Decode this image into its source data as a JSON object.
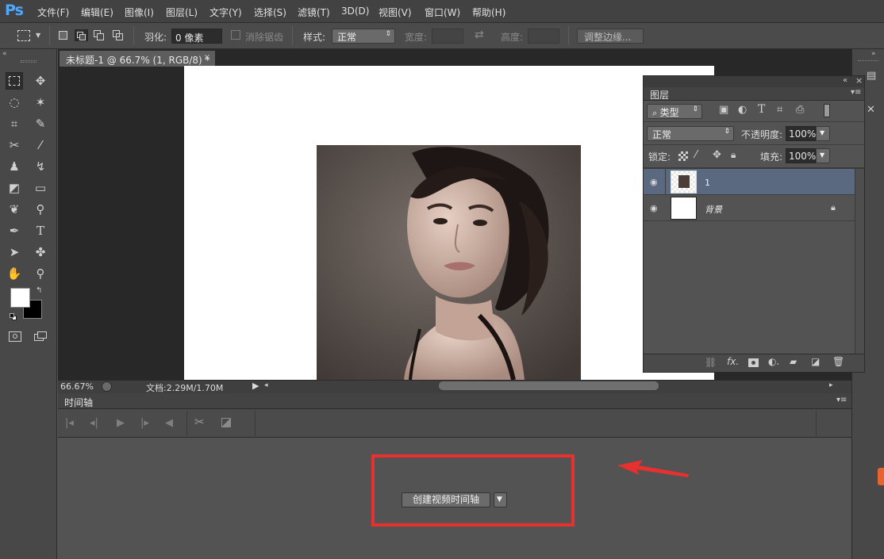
{
  "app": {
    "logo": "Ps"
  },
  "menu": [
    "文件(F)",
    "编辑(E)",
    "图像(I)",
    "图层(L)",
    "文字(Y)",
    "选择(S)",
    "滤镜(T)",
    "3D(D)",
    "视图(V)",
    "窗口(W)",
    "帮助(H)"
  ],
  "options": {
    "feather_label": "羽化:",
    "feather_value": "0 像素",
    "antialias_label": "消除锯齿",
    "style_label": "样式:",
    "style_value": "正常",
    "width_label": "宽度:",
    "height_label": "高度:",
    "refine_edge": "调整边缘..."
  },
  "document": {
    "tab_title": "未标题-1 @ 66.7% (1, RGB/8) *",
    "zoom": "66.67%",
    "doc_size": "文档:2.29M/1.70M"
  },
  "timeline": {
    "title": "时间轴",
    "create_button": "创建视频时间轴"
  },
  "layers": {
    "tab": "图层",
    "filter_kind": "类型",
    "blend_mode": "正常",
    "opacity_label": "不透明度:",
    "opacity_value": "100%",
    "lock_label": "锁定:",
    "fill_label": "填充:",
    "fill_value": "100%",
    "items": [
      {
        "name": "1",
        "selected": true
      },
      {
        "name": "背景",
        "locked": true
      }
    ]
  },
  "colors": {
    "accent_ps": "#4fa8ff",
    "highlight": "#e8312f",
    "selected_layer": "#5b6980"
  }
}
